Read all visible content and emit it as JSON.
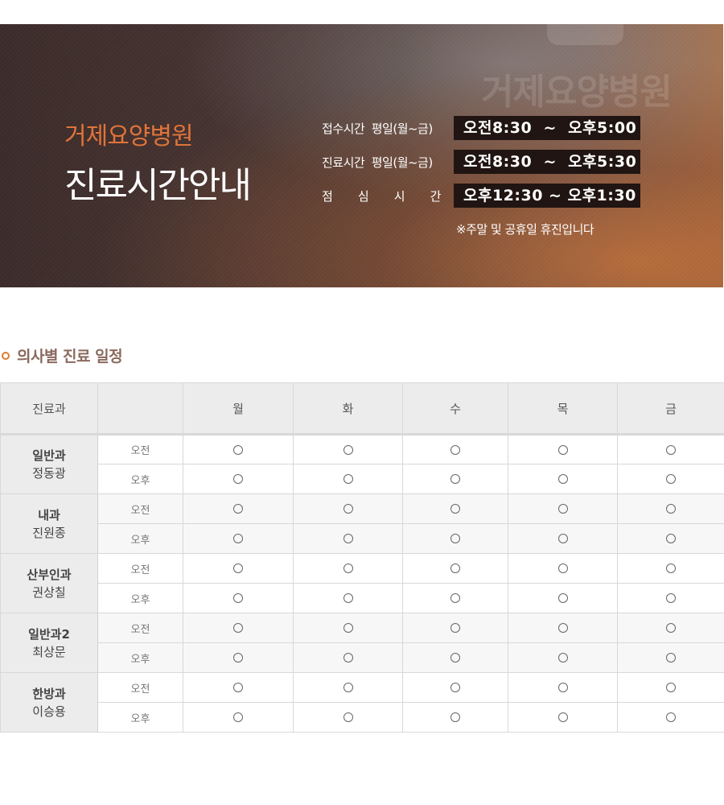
{
  "banner": {
    "ghost_text": "거제요양병원",
    "hospital_name": "거제요양병원",
    "page_heading": "진료시간안내",
    "hours": [
      {
        "label": "접수시간  평일(월~금)",
        "time": "오전8:30  ~  오후5:00"
      },
      {
        "label": "진료시간  평일(월~금)",
        "time": "오전8:30  ~  오후5:30"
      },
      {
        "label_chars": [
          "점",
          "심",
          "시",
          "간"
        ],
        "time": "오후12:30 ~ 오후1:30"
      }
    ],
    "note": "※주말 및 공휴일 휴진입니다"
  },
  "section": {
    "title": "의사별 진료 일정"
  },
  "schedule": {
    "headers": [
      "진료과",
      "",
      "월",
      "화",
      "수",
      "목",
      "금"
    ],
    "sessions": [
      "오전",
      "오후"
    ],
    "departments": [
      {
        "dept": "일반과",
        "doctor": "정동광"
      },
      {
        "dept": "내과",
        "doctor": "진원종"
      },
      {
        "dept": "산부인과",
        "doctor": "권상칠"
      },
      {
        "dept": "일반과2",
        "doctor": "최상문"
      },
      {
        "dept": "한방과",
        "doctor": "이승용"
      }
    ],
    "mark_icon": "circle-icon"
  },
  "colors": {
    "accent": "#e07a2e",
    "section_title": "#8a6a5e",
    "hospital_name": "#e0743a",
    "time_box": "#201512"
  }
}
